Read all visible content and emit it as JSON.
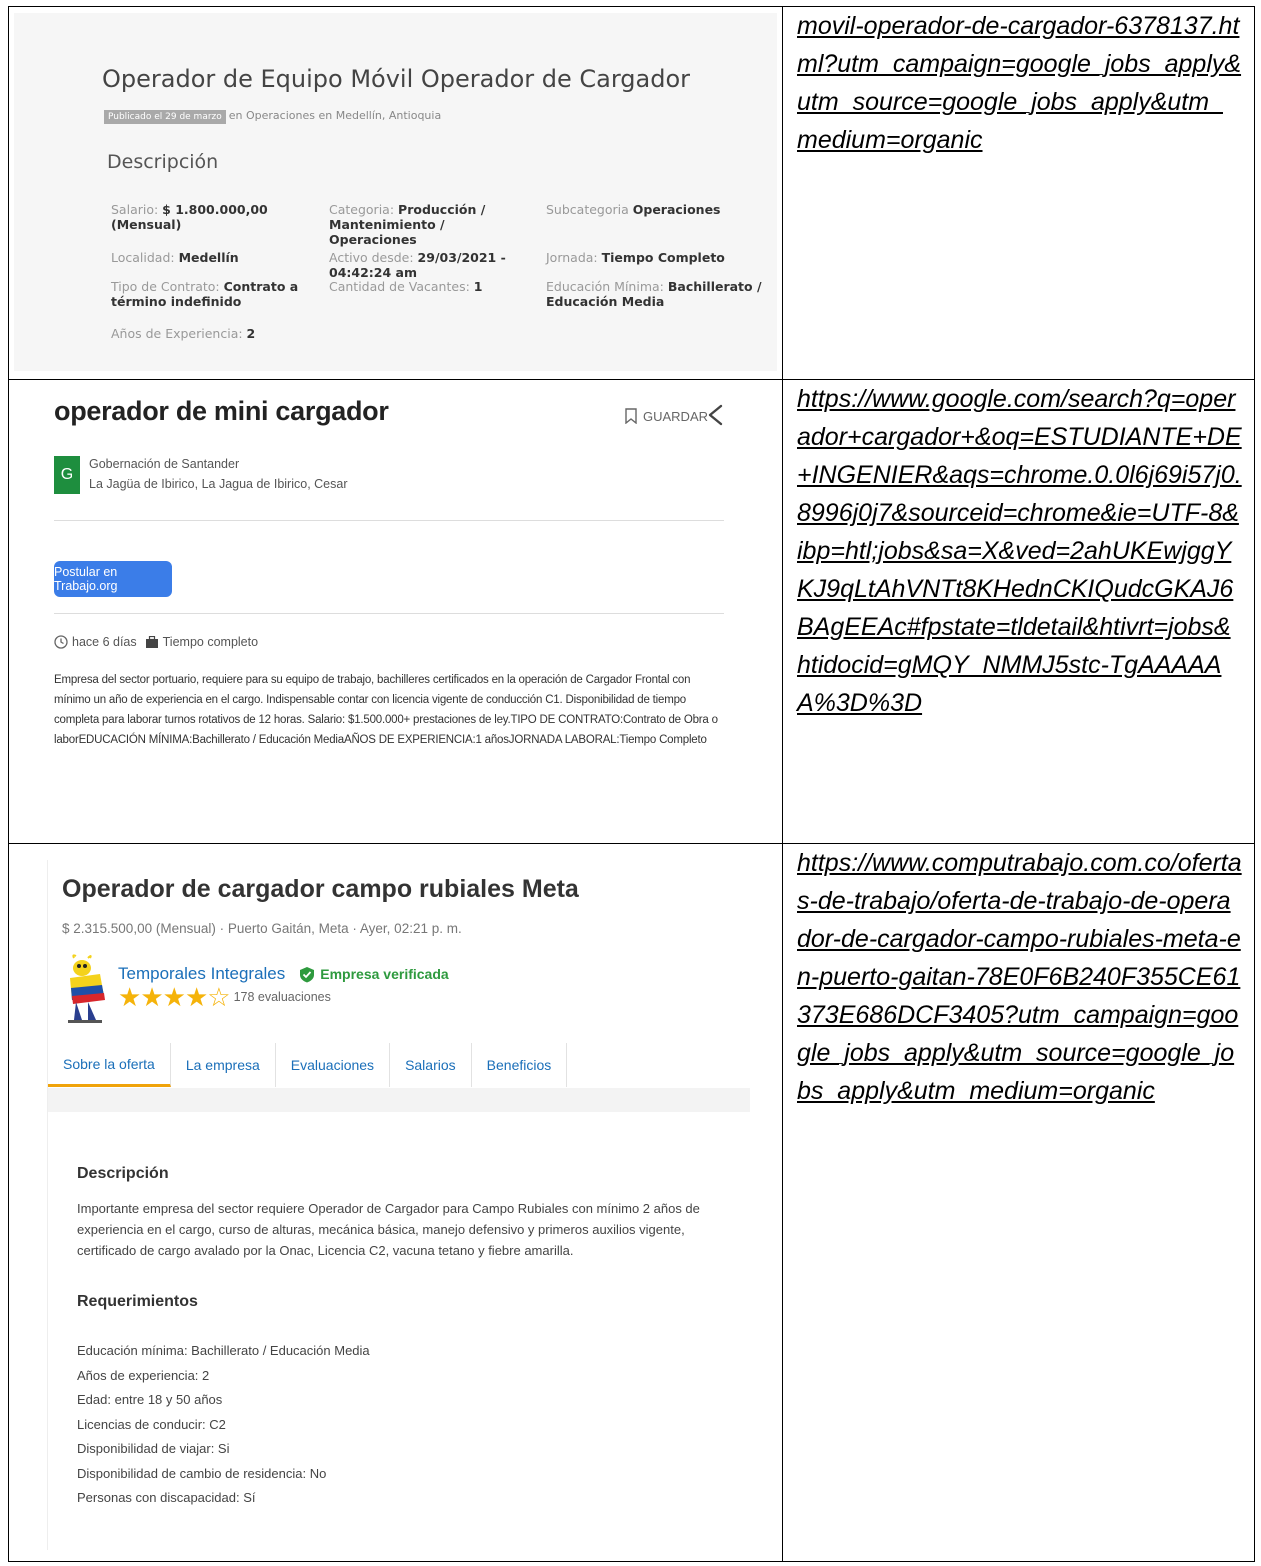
{
  "row1": {
    "title": "Operador de Equipo Móvil Operador de Cargador",
    "published_badge": "Publicado el 29 de marzo",
    "published_rest": "en Operaciones en Medellín, Antioquia",
    "section": "Descripción",
    "fields": [
      {
        "label": "Salario: ",
        "value": "$ 1.800.000,00 (Mensual)"
      },
      {
        "label": "Categoria: ",
        "value": "Producción / Mantenimiento / Operaciones"
      },
      {
        "label": "Subcategoria ",
        "value": "Operaciones"
      },
      {
        "label": "Localidad: ",
        "value": "Medellín"
      },
      {
        "label": "Activo desde: ",
        "value": "29/03/2021 - 04:42:24 am"
      },
      {
        "label": "Jornada: ",
        "value": "Tiempo Completo"
      },
      {
        "label": "Tipo de Contrato: ",
        "value": "Contrato a término indefinido"
      },
      {
        "label": "Cantidad de Vacantes: ",
        "value": "1"
      },
      {
        "label": "Educación Mínima: ",
        "value": "Bachillerato / Educación Media"
      },
      {
        "label": "Años de Experiencia: ",
        "value": "2"
      }
    ],
    "url": "movil-operador-de-cargador-6378137.html?utm_campaign=google_jobs_apply&utm_source=google_jobs_apply&utm_medium=organic"
  },
  "row2": {
    "title": "operador de mini cargador",
    "save_label": "GUARDAR",
    "logo_letter": "G",
    "org": "Gobernación de Santander",
    "location": "La Jagüa de Ibirico, La Jagua de Ibirico, Cesar",
    "apply_label": "Postular en Trabajo.org",
    "posted": "hace 6 días",
    "type": "Tiempo completo",
    "body": "Empresa del sector portuario, requiere para su equipo de trabajo, bachilleres certificados en la operación de Cargador Frontal con mínimo un año de experiencia en el cargo. Indispensable contar con licencia vigente de conducción C1. Disponibilidad de tiempo completa para laborar turnos rotativos de 12 horas. Salario: $1.500.000+ prestaciones de ley.TIPO DE CONTRATO:Contrato de Obra o laborEDUCACIÓN MÍNIMA:Bachillerato / Educación MediaAÑOS DE EXPERIENCIA:1 añosJORNADA LABORAL:Tiempo Completo",
    "url": "https://www.google.com/search?q=operador+cargador+&oq=ESTUDIANTE+DE+INGENIER&aqs=chrome.0.0l6j69i57j0.8996j0j7&sourceid=chrome&ie=UTF-8&ibp=htl;jobs&sa=X&ved=2ahUKEwjggYKJ9qLtAhVNTt8KHednCKIQudcGKAJ6BAgEEAc#fpstate=tldetail&htivrt=jobs&htidocid=gMQY_NMMJ5stc-TgAAAAAA%3D%3D"
  },
  "row3": {
    "title": "Operador de cargador campo rubiales Meta",
    "subline": "$ 2.315.500,00 (Mensual) ·  Puerto Gaitán, Meta ·  Ayer, 02:21 p. m.",
    "company": "Temporales Integrales",
    "verified": "Empresa verificada",
    "rating": 4,
    "reviews": "178 evaluaciones",
    "tabs": [
      "Sobre la oferta",
      "La empresa",
      "Evaluaciones",
      "Salarios",
      "Beneficios"
    ],
    "desc_heading": "Descripción",
    "desc_text": "Importante empresa del sector requiere Operador de Cargador para Campo Rubiales con mínimo 2 años de experiencia en el cargo, curso de alturas, mecánica básica, manejo defensivo y primeros auxilios vigente, certificado de cargo avalado por la Onac, Licencia C2, vacuna tetano y fiebre amarilla.",
    "req_heading": "Requerimientos",
    "requirements": [
      "Educación mínima: Bachillerato / Educación Media",
      "Años de experiencia: 2",
      "Edad: entre 18 y 50 años",
      "Licencias de conducir: C2",
      "Disponibilidad de viajar: Si",
      "Disponibilidad de cambio de residencia: No",
      "Personas con discapacidad: Sí"
    ],
    "url": "https://www.computrabajo.com.co/ofertas-de-trabajo/oferta-de-trabajo-de-operador-de-cargador-campo-rubiales-meta-en-puerto-gaitan-78E0F6B240F355CE61373E686DCF3405?utm_campaign=google_jobs_apply&utm_source=google_jobs_apply&utm_medium=organic"
  },
  "colors": {
    "link": "#1b6fb9",
    "apply_button": "#3b7de8",
    "verified": "#2e9a3e",
    "star": "#f5b30a",
    "tab_underline": "#f0a30a",
    "org_logo": "#1e8e3e"
  }
}
